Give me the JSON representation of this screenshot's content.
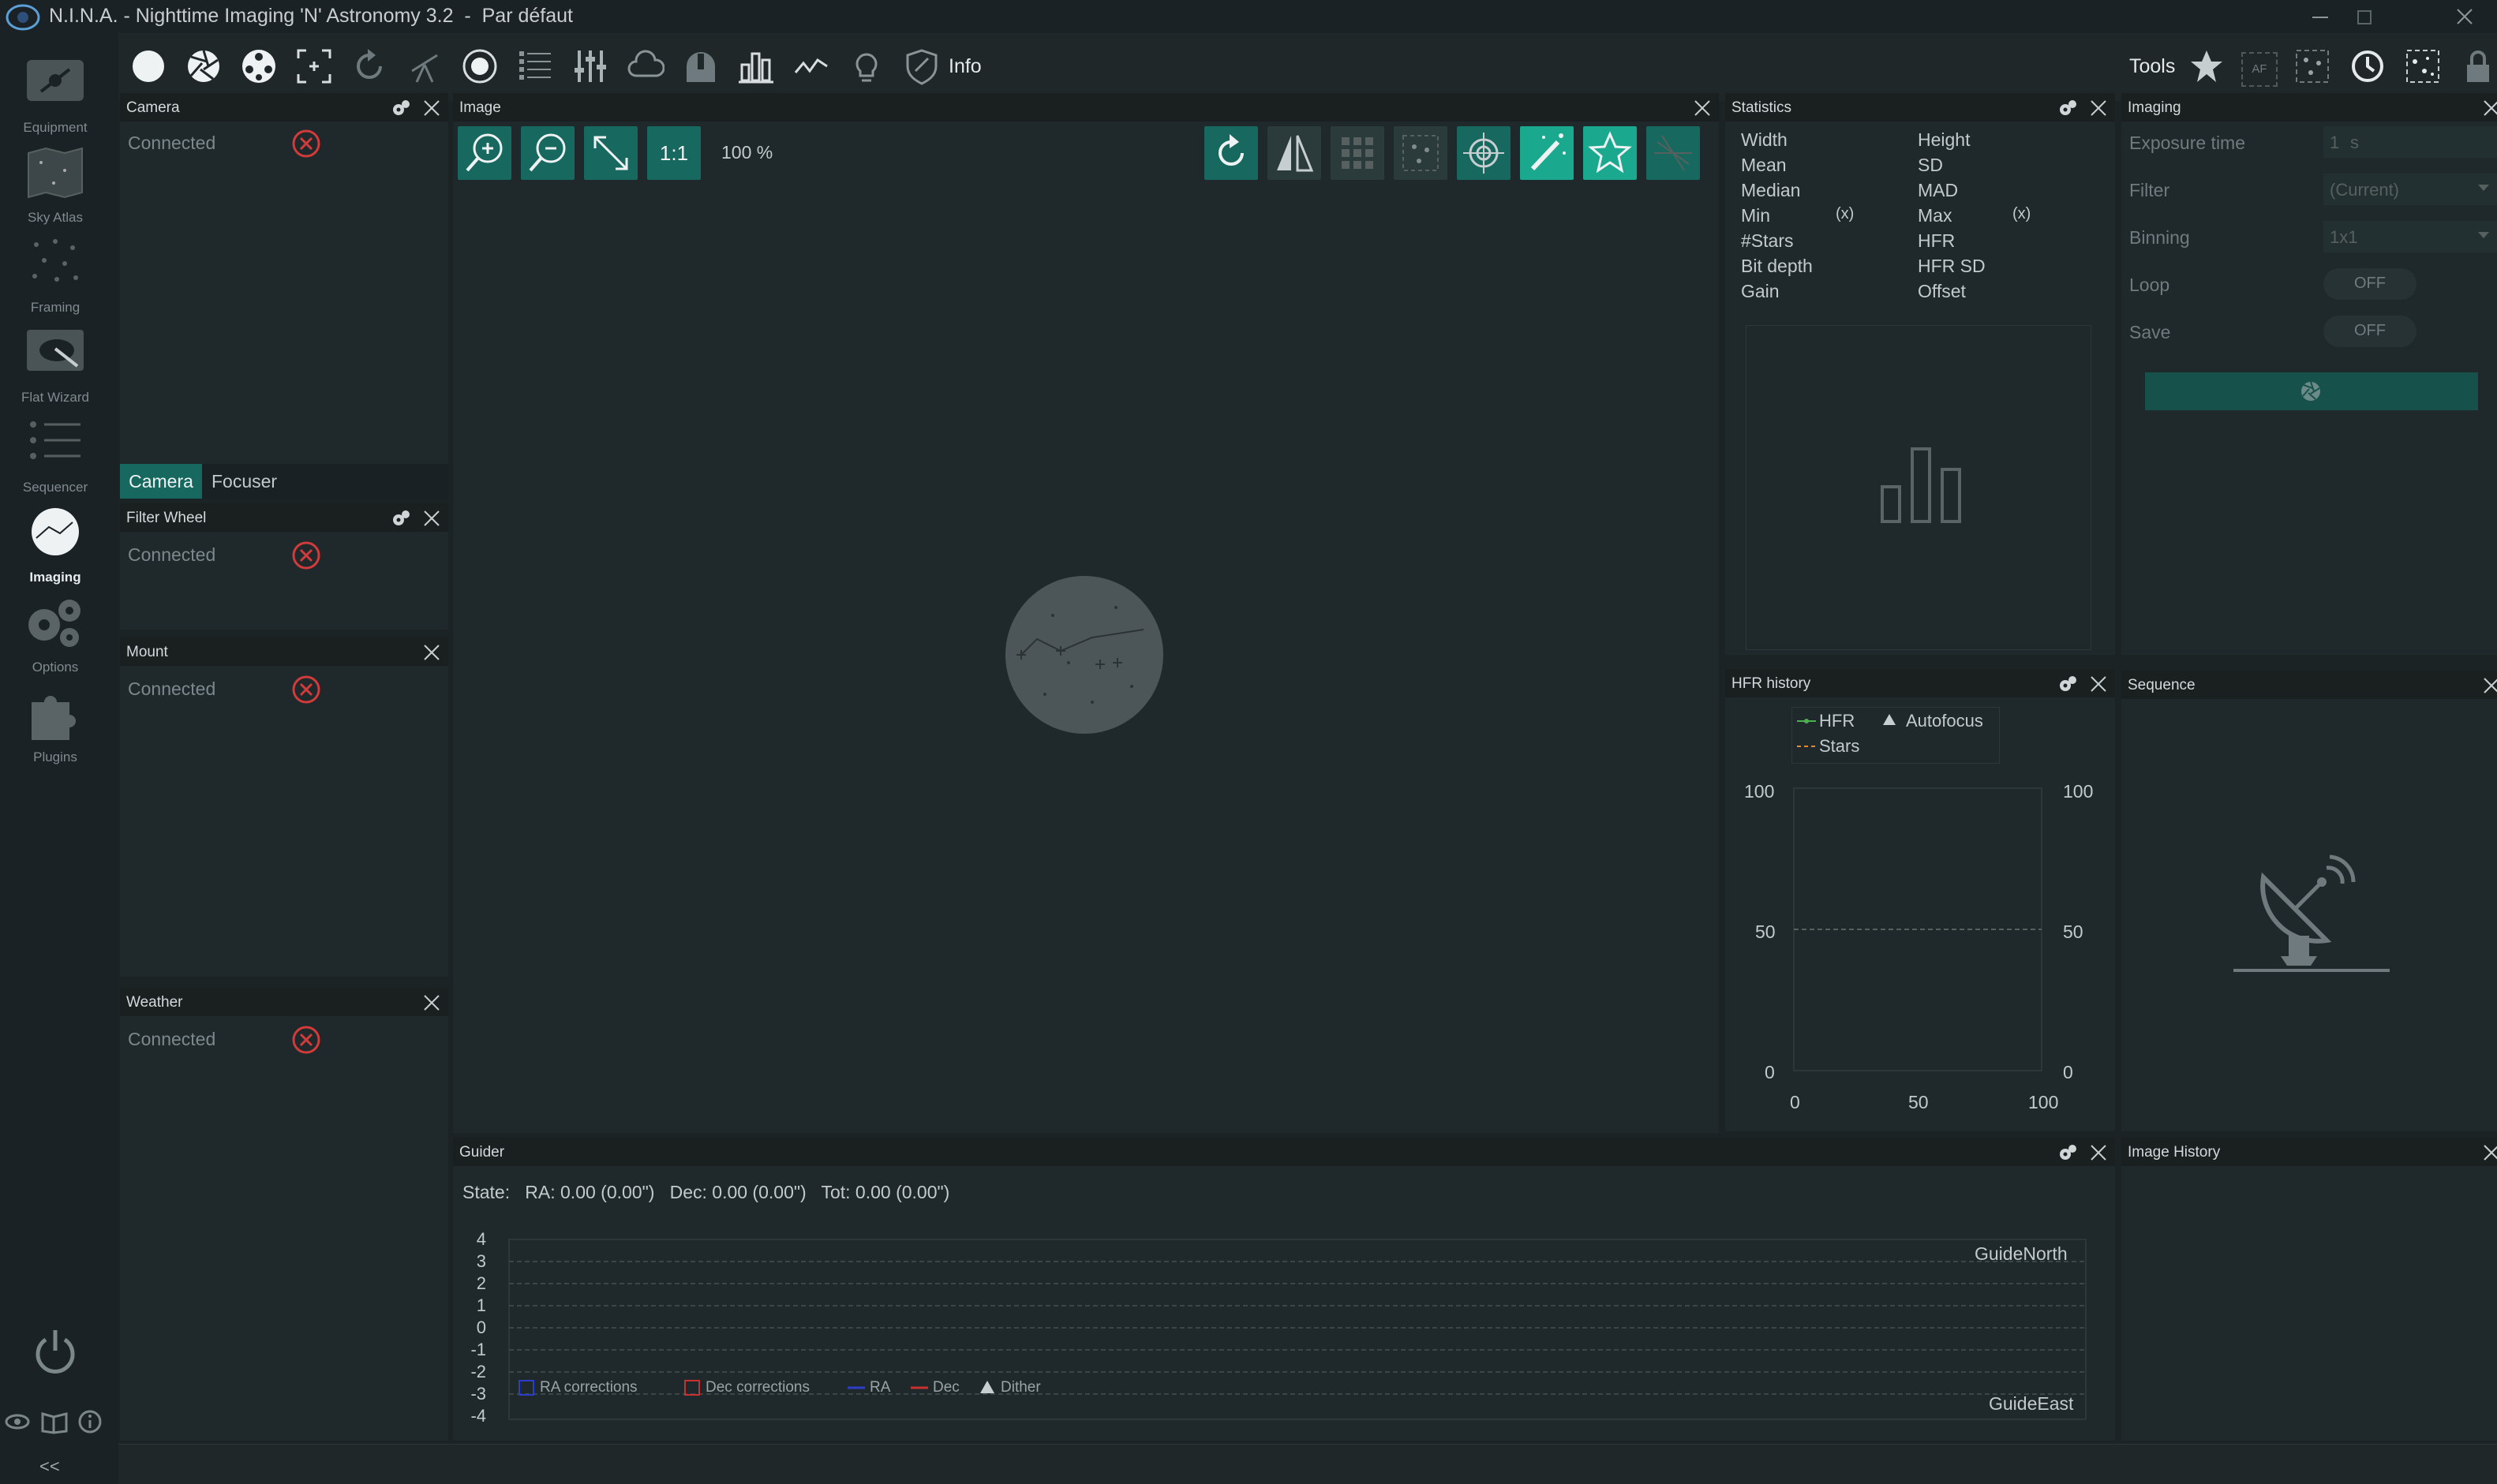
{
  "app": {
    "title": "N.I.N.A. - Nighttime Imaging 'N' Astronomy 3.2",
    "profile": "Par défaut"
  },
  "sidebar": {
    "items": [
      {
        "label": "Equipment"
      },
      {
        "label": "Sky Atlas"
      },
      {
        "label": "Framing"
      },
      {
        "label": "Flat Wizard"
      },
      {
        "label": "Sequencer"
      },
      {
        "label": "Imaging"
      },
      {
        "label": "Options"
      },
      {
        "label": "Plugins"
      }
    ],
    "collapse_label": "<<"
  },
  "toolbar": {
    "info_label": "Info",
    "tools_label": "Tools",
    "af_label": "AF"
  },
  "camera_panel": {
    "title": "Camera",
    "status": "Connected",
    "tabs": [
      "Camera",
      "Focuser"
    ]
  },
  "filterwheel_panel": {
    "title": "Filter Wheel",
    "status": "Connected"
  },
  "mount_panel": {
    "title": "Mount",
    "status": "Connected"
  },
  "weather_panel": {
    "title": "Weather",
    "status": "Connected"
  },
  "image_panel": {
    "title": "Image",
    "one_to_one": "1:1",
    "zoom": "100 %"
  },
  "statistics": {
    "title": "Statistics",
    "left": [
      "Width",
      "Mean",
      "Median",
      "Min",
      "#Stars",
      "Bit depth",
      "Gain"
    ],
    "right": [
      "Height",
      "SD",
      "MAD",
      "Max",
      "HFR",
      "HFR SD",
      "Offset"
    ],
    "min_x": "(x)",
    "max_x": "(x)"
  },
  "imaging_panel": {
    "title": "Imaging",
    "rows": [
      {
        "label": "Exposure time",
        "value": "1",
        "unit": "s"
      },
      {
        "label": "Filter",
        "value": "(Current)"
      },
      {
        "label": "Binning",
        "value": "1x1"
      },
      {
        "label": "Loop",
        "value": "OFF"
      },
      {
        "label": "Save",
        "value": "OFF"
      }
    ]
  },
  "hfr_history": {
    "title": "HFR history",
    "legend": {
      "hfr": "HFR",
      "autofocus": "Autofocus",
      "stars": "Stars"
    },
    "y_ticks_left": [
      "100",
      "50",
      "0"
    ],
    "y_ticks_right": [
      "100",
      "50",
      "0"
    ],
    "x_ticks": [
      "0",
      "50",
      "100"
    ]
  },
  "sequence_panel": {
    "title": "Sequence"
  },
  "guider": {
    "title": "Guider",
    "state_label": "State:",
    "ra": "RA: 0.00 (0.00\")",
    "dec": "Dec: 0.00 (0.00\")",
    "tot": "Tot: 0.00 (0.00\")",
    "y_ticks": [
      "4",
      "3",
      "2",
      "1",
      "0",
      "-1",
      "-2",
      "-3",
      "-4"
    ],
    "north_label": "GuideNorth",
    "east_label": "GuideEast",
    "legend": {
      "ra_corr": "RA corrections",
      "dec_corr": "Dec corrections",
      "ra": "RA",
      "dec": "Dec",
      "dither": "Dither"
    }
  },
  "image_history": {
    "title": "Image History"
  },
  "colors": {
    "accent": "#1aa88e",
    "button": "#17685e",
    "error": "#d23b3b"
  }
}
